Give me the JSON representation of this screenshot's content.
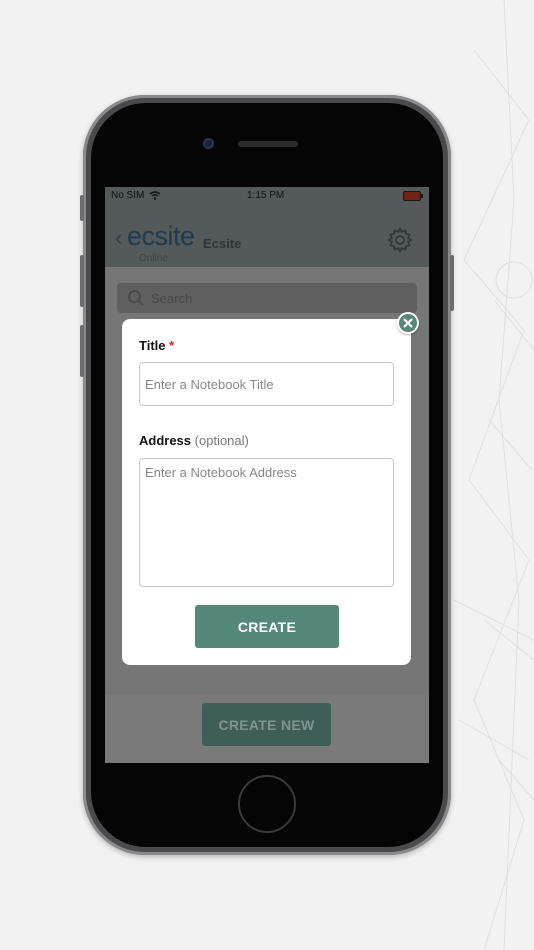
{
  "status_bar": {
    "carrier": "No SIM",
    "time": "1:15 PM"
  },
  "header": {
    "logo": "ecsite",
    "logo_subtitle": "Online",
    "app_name": "Ecsite",
    "settings_icon": "gear-icon",
    "back_icon": "chevron-left-icon"
  },
  "search": {
    "placeholder": "Search",
    "icon": "search-icon"
  },
  "footer": {
    "create_new_label": "CREATE NEW"
  },
  "modal": {
    "title_label": "Title",
    "required_marker": "*",
    "title_placeholder": "Enter a Notebook Title",
    "title_value": "",
    "address_label": "Address",
    "address_optional": "(optional)",
    "address_placeholder": "Enter a Notebook Address",
    "address_value": "",
    "create_label": "CREATE",
    "close_icon": "close-icon"
  },
  "colors": {
    "accent": "#56887a",
    "logo": "#3f74a2",
    "required": "#d0221c"
  }
}
